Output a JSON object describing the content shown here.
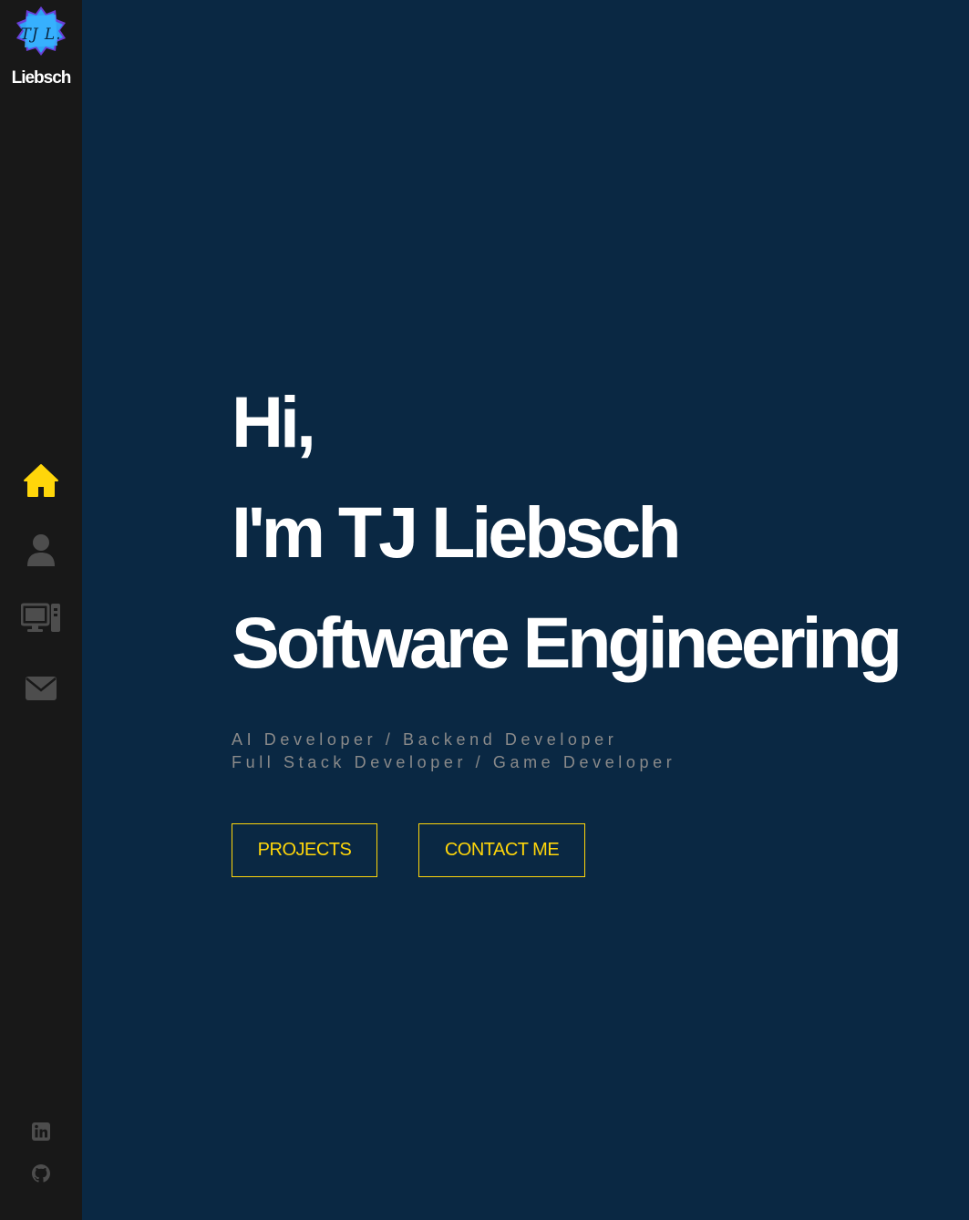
{
  "brand": {
    "logo_text": "TJ L.",
    "name": "Liebsch"
  },
  "nav": {
    "items": [
      {
        "icon": "home-icon",
        "active": true
      },
      {
        "icon": "user-icon",
        "active": false
      },
      {
        "icon": "computer-icon",
        "active": false
      },
      {
        "icon": "envelope-icon",
        "active": false
      }
    ]
  },
  "social": {
    "items": [
      {
        "icon": "linkedin-icon"
      },
      {
        "icon": "github-icon"
      }
    ]
  },
  "hero": {
    "line1": "Hi,",
    "line2": "I'm TJ Liebsch",
    "line3": "Software Engineering",
    "subtitle_line1": "AI Developer / Backend Developer",
    "subtitle_line2": "Full Stack Developer / Game Developer",
    "projects_label": "PROJECTS",
    "contact_label": "CONTACT ME"
  },
  "colors": {
    "accent": "#ffd60a",
    "sidebar_bg": "#181818",
    "main_bg": "#0a2843",
    "icon_inactive": "#4d4d4d"
  }
}
